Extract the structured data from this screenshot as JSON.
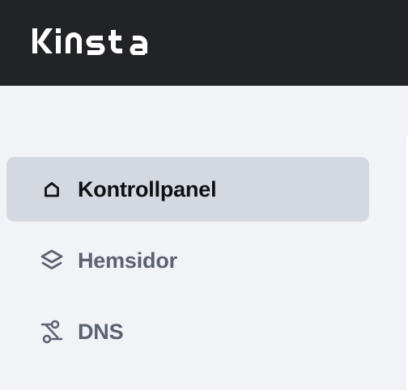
{
  "header": {
    "logo_text": "KINSTA",
    "colors": {
      "background": "#222327",
      "logo": "#ffffff"
    }
  },
  "sidebar": {
    "items": [
      {
        "label": "Kontrollpanel",
        "icon": "home-icon",
        "active": true
      },
      {
        "label": "Hemsidor",
        "icon": "layers-icon",
        "active": false
      },
      {
        "label": "DNS",
        "icon": "routing-icon",
        "active": false
      }
    ],
    "colors": {
      "active_bg": "#d4d8e0",
      "active_text": "#0f1014",
      "inactive_text": "#5d6272",
      "page_bg": "#f2f3f7"
    }
  }
}
